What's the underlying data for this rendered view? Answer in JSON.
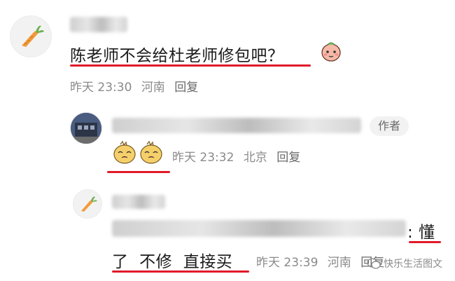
{
  "comment": {
    "text": "陈老师不会给杜老师修包吧？",
    "time": "昨天 23:30",
    "location": "河南",
    "reply_label": "回复",
    "emoji_icon": "peach-face-emoji"
  },
  "reply_1": {
    "badge": "作者",
    "time": "昨天 23:32",
    "location": "北京",
    "reply_label": "回复",
    "emoji_icon": "two-crying-chick-emoji"
  },
  "reply_2": {
    "text_part_a": ": 懂",
    "text_part_b": "了  不修  直接买",
    "time": "昨天 23:39",
    "location": "河南",
    "reply_label": "回复"
  },
  "watermark": {
    "text": "快乐生活图文"
  },
  "colors": {
    "underline": "#e01a2a",
    "meta": "#8a8a8a"
  }
}
